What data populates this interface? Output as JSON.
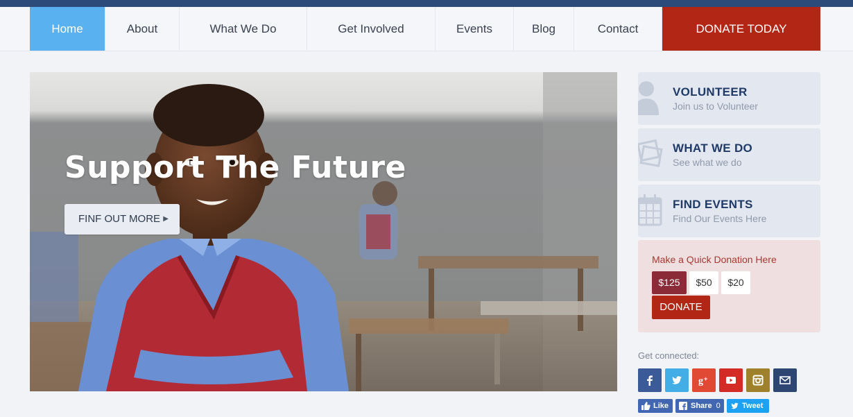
{
  "nav": {
    "items": [
      {
        "label": "Home",
        "active": true
      },
      {
        "label": "About"
      },
      {
        "label": "What We Do"
      },
      {
        "label": "Get Involved"
      },
      {
        "label": "Events"
      },
      {
        "label": "Blog"
      },
      {
        "label": "Contact"
      }
    ],
    "donate_label": "DONATE TODAY"
  },
  "hero": {
    "title": "Support The Future",
    "button_label": "FINF OUT MORE",
    "button_icon": "caret-right-icon"
  },
  "cards": [
    {
      "title": "VOLUNTEER",
      "subtitle": "Join us to Volunteer",
      "icon": "user-icon"
    },
    {
      "title": "WHAT WE DO",
      "subtitle": "See what we do",
      "icon": "photos-icon"
    },
    {
      "title": "FIND EVENTS",
      "subtitle": "Find Our Events Here",
      "icon": "calendar-icon"
    }
  ],
  "quick_donation": {
    "title": "Make a Quick Donation Here",
    "amounts": [
      {
        "label": "$125",
        "selected": true
      },
      {
        "label": "$50"
      },
      {
        "label": "$20"
      }
    ],
    "button_label": "DONATE"
  },
  "social": {
    "heading": "Get connected:",
    "icons": [
      {
        "name": "facebook-icon",
        "color": "#3b5a98"
      },
      {
        "name": "twitter-icon",
        "color": "#42aee5"
      },
      {
        "name": "google-plus-icon",
        "color": "#e04a35"
      },
      {
        "name": "youtube-icon",
        "color": "#d32b25"
      },
      {
        "name": "instagram-icon",
        "color": "#a0812b"
      },
      {
        "name": "email-icon",
        "color": "#2d4672"
      }
    ],
    "like_label": "Like",
    "share_label": "Share",
    "share_count": "0",
    "tweet_label": "Tweet"
  },
  "colors": {
    "accent_blue": "#5ab1f0",
    "donate_red": "#b22616",
    "navy": "#2c4a7a",
    "selected_amount": "#8b2b38"
  }
}
